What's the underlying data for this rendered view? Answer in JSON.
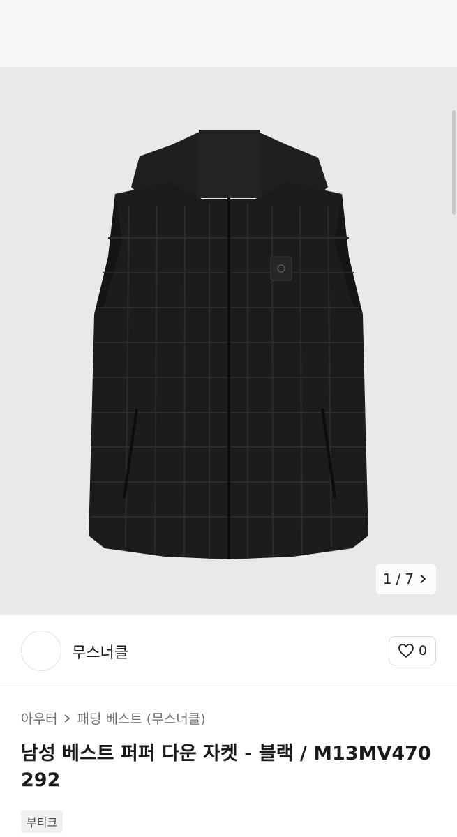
{
  "gallery": {
    "current_index": "1",
    "separator": "/",
    "total": "7"
  },
  "seller": {
    "name": "무스너클",
    "like_count": "0"
  },
  "breadcrumb": {
    "items": [
      "아우터",
      "패딩 베스트 (무스너클)"
    ]
  },
  "product": {
    "title": "남성 베스트 퍼퍼 다운 자켓 - 블랙 / M13MV470292",
    "tag": "부티크"
  },
  "colors": {
    "gallery_bg": "#e9e9e9",
    "vest": "#1c1c1c",
    "text_primary": "#1a1a1a",
    "text_secondary": "#6d6d6d"
  },
  "icons": {
    "counter_next": "chevron-right-icon",
    "like": "heart-outline-icon",
    "breadcrumb_separator": "chevron-right-icon"
  }
}
